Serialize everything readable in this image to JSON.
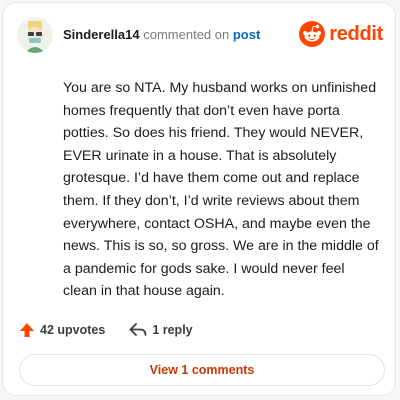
{
  "header": {
    "username": "Sinderella14",
    "action_text": "commented on",
    "post_link": "post"
  },
  "brand": {
    "wordmark": "reddit",
    "icon": "reddit-snoo-icon",
    "color": "#ff4500"
  },
  "comment": {
    "lines": [
      "You are so NTA. My husband works on unfinished",
      "homes frequently that don’t even have porta",
      "potties. So does his friend. They would NEVER,",
      "EVER urinate in a house. That is absolutely",
      "grotesque. I’d have them come out and replace",
      "them. If they don’t, I’d write reviews about them",
      "everywhere, contact OSHA, and maybe even the",
      "news. This is so, so gross. We are in the middle of",
      "a pandemic for gods sake. I would never feel",
      "clean in that house again."
    ]
  },
  "actions": {
    "upvotes_label": "42 upvotes",
    "upvote_icon": "upvote-arrow-icon",
    "upvote_color": "#ff4500",
    "reply_label": "1 reply",
    "reply_icon": "reply-arrow-icon"
  },
  "footer": {
    "view_comments_label": "View 1 comments",
    "view_comments_color": "#cc3700"
  }
}
